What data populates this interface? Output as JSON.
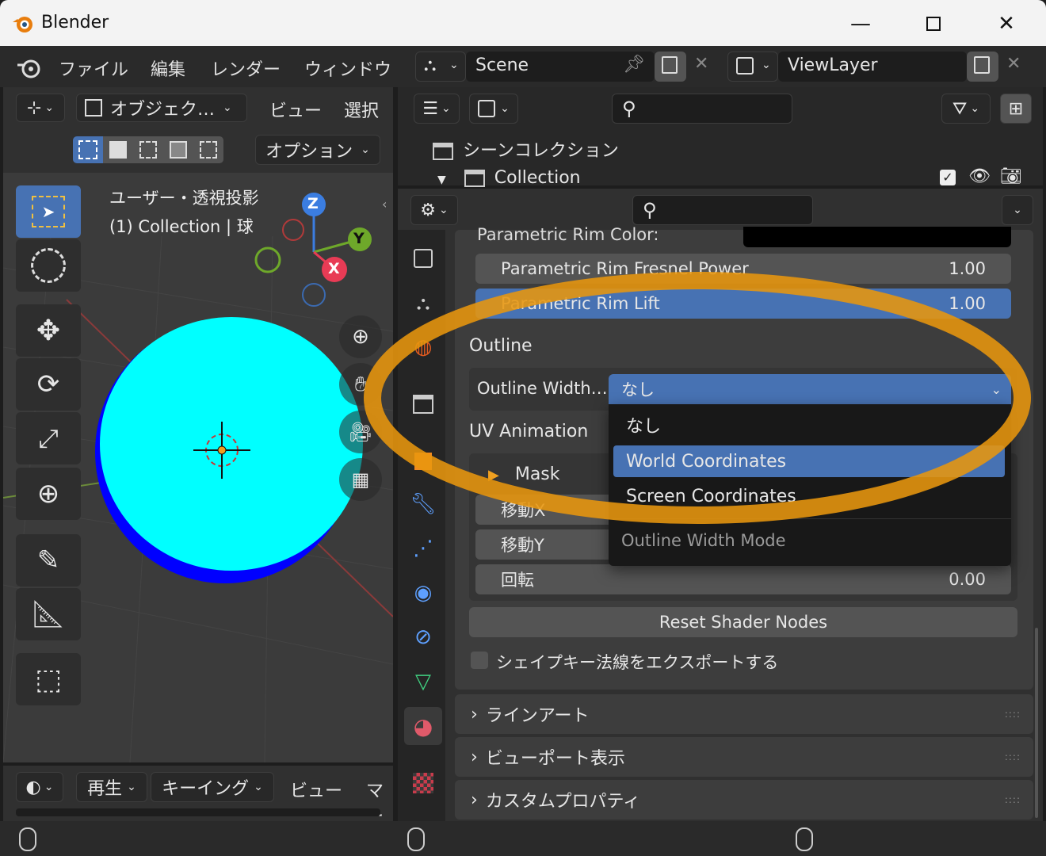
{
  "app": {
    "title": "Blender"
  },
  "window": {
    "minimize_icon": "minimize-icon",
    "maximize_icon": "maximize-icon",
    "close_icon": "close-icon"
  },
  "menu": {
    "items": [
      "ファイル",
      "編集",
      "レンダー",
      "ウィンドウ"
    ]
  },
  "scene": {
    "name": "Scene",
    "view_layer": "ViewLayer"
  },
  "viewport": {
    "mode": "オブジェク…",
    "view_menu": "ビュー",
    "select_menu": "選択",
    "options": "オプション",
    "overlay_line1": "ユーザー・透視投影",
    "overlay_line2": "(1) Collection | 球",
    "gizmo": {
      "z": "Z",
      "y": "Y",
      "x": "X"
    }
  },
  "timeline": {
    "playback": "再生",
    "keying": "キーイング",
    "view": "ビュー",
    "marker": "マー"
  },
  "outliner": {
    "scene_collection": "シーンコレクション",
    "collection": "Collection"
  },
  "properties": {
    "rim_color_label": "Parametric Rim Color:",
    "rim_fresnel": {
      "label": "Parametric Rim Fresnel Power",
      "value": "1.00"
    },
    "rim_lift": {
      "label": "Parametric Rim Lift",
      "value": "1.00"
    },
    "outline_section": "Outline",
    "outline_width_label": "Outline Width…",
    "outline_width_value": "なし",
    "uv_section": "UV Animation",
    "mask_label": "Mask",
    "move_x": "移動X",
    "move_y": "移動Y",
    "rotation": {
      "label": "回転",
      "value": "0.00"
    },
    "reset_button": "Reset Shader Nodes",
    "export_checkbox": "シェイプキー法線をエクスポートする",
    "panels": [
      "ラインアート",
      "ビューポート表示",
      "カスタムプロパティ"
    ]
  },
  "dropdown": {
    "options": [
      "なし",
      "World Coordinates",
      "Screen Coordinates"
    ],
    "selected": "World Coordinates",
    "title": "Outline Width Mode"
  },
  "colors": {
    "accent": "#4772b3",
    "highlight_ring": "#e8960e",
    "sphere_light": "#00ffff",
    "sphere_dark": "#0000ff"
  }
}
